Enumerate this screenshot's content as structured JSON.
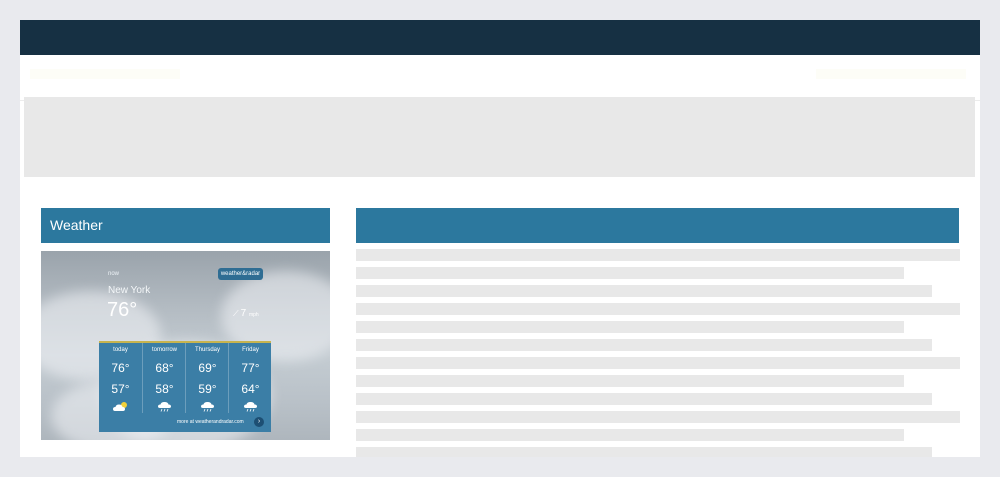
{
  "sidebar_widget": {
    "title": "Weather"
  },
  "weather": {
    "now_label": "now",
    "brand": "weather&radar",
    "city": "New York",
    "current_temp": "76°",
    "wind_speed": "7",
    "wind_unit": "mph",
    "forecast": [
      {
        "day": "today",
        "high": "76°",
        "low": "57°",
        "icon": "partly-cloudy-icon"
      },
      {
        "day": "tomorrow",
        "high": "68°",
        "low": "58°",
        "icon": "rain-cloud-icon"
      },
      {
        "day": "Thursday",
        "high": "69°",
        "low": "59°",
        "icon": "rain-cloud-icon"
      },
      {
        "day": "Friday",
        "high": "77°",
        "low": "64°",
        "icon": "rain-cloud-icon"
      }
    ],
    "more_link": "more at weatherandradar.com"
  },
  "colors": {
    "topbar": "#163043",
    "section_header": "#2c789e",
    "forecast_panel": "#3b7ea6",
    "placeholder": "#e8e8e8"
  }
}
